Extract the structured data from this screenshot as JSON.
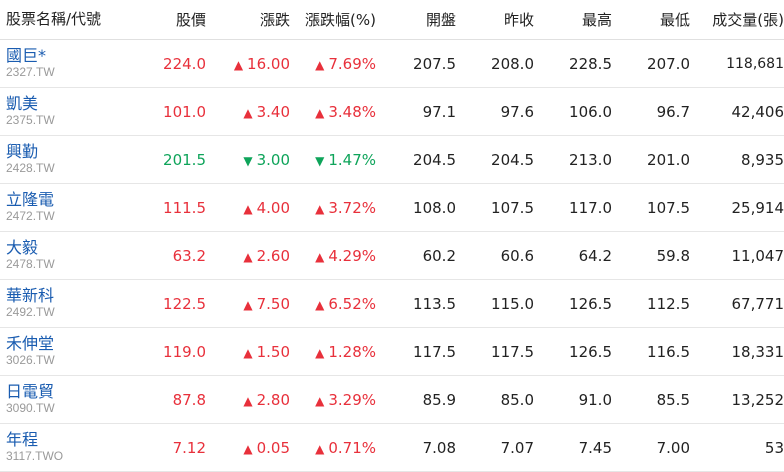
{
  "headers": [
    "股票名稱/代號",
    "股價",
    "漲跌",
    "漲跌幅(%)",
    "開盤",
    "昨收",
    "最高",
    "最低",
    "成交量(張)"
  ],
  "colors": {
    "up": "#e8303b",
    "down": "#0ea45a",
    "link": "#1a5cb0"
  },
  "rows": [
    {
      "name": "國巨*",
      "code": "2327.TW",
      "price": "224.0",
      "dir": "up",
      "change": "16.00",
      "pct": "7.69%",
      "open": "207.5",
      "prev": "208.0",
      "high": "228.5",
      "low": "207.0",
      "volume": "118,681"
    },
    {
      "name": "凱美",
      "code": "2375.TW",
      "price": "101.0",
      "dir": "up",
      "change": "3.40",
      "pct": "3.48%",
      "open": "97.1",
      "prev": "97.6",
      "high": "106.0",
      "low": "96.7",
      "volume": "42,406"
    },
    {
      "name": "興勤",
      "code": "2428.TW",
      "price": "201.5",
      "dir": "down",
      "change": "3.00",
      "pct": "1.47%",
      "open": "204.5",
      "prev": "204.5",
      "high": "213.0",
      "low": "201.0",
      "volume": "8,935"
    },
    {
      "name": "立隆電",
      "code": "2472.TW",
      "price": "111.5",
      "dir": "up",
      "change": "4.00",
      "pct": "3.72%",
      "open": "108.0",
      "prev": "107.5",
      "high": "117.0",
      "low": "107.5",
      "volume": "25,914"
    },
    {
      "name": "大毅",
      "code": "2478.TW",
      "price": "63.2",
      "dir": "up",
      "change": "2.60",
      "pct": "4.29%",
      "open": "60.2",
      "prev": "60.6",
      "high": "64.2",
      "low": "59.8",
      "volume": "11,047"
    },
    {
      "name": "華新科",
      "code": "2492.TW",
      "price": "122.5",
      "dir": "up",
      "change": "7.50",
      "pct": "6.52%",
      "open": "113.5",
      "prev": "115.0",
      "high": "126.5",
      "low": "112.5",
      "volume": "67,771"
    },
    {
      "name": "禾伸堂",
      "code": "3026.TW",
      "price": "119.0",
      "dir": "up",
      "change": "1.50",
      "pct": "1.28%",
      "open": "117.5",
      "prev": "117.5",
      "high": "126.5",
      "low": "116.5",
      "volume": "18,331"
    },
    {
      "name": "日電貿",
      "code": "3090.TW",
      "price": "87.8",
      "dir": "up",
      "change": "2.80",
      "pct": "3.29%",
      "open": "85.9",
      "prev": "85.0",
      "high": "91.0",
      "low": "85.5",
      "volume": "13,252"
    },
    {
      "name": "年程",
      "code": "3117.TWO",
      "price": "7.12",
      "dir": "up",
      "change": "0.05",
      "pct": "0.71%",
      "open": "7.08",
      "prev": "7.07",
      "high": "7.45",
      "low": "7.00",
      "volume": "53"
    }
  ]
}
